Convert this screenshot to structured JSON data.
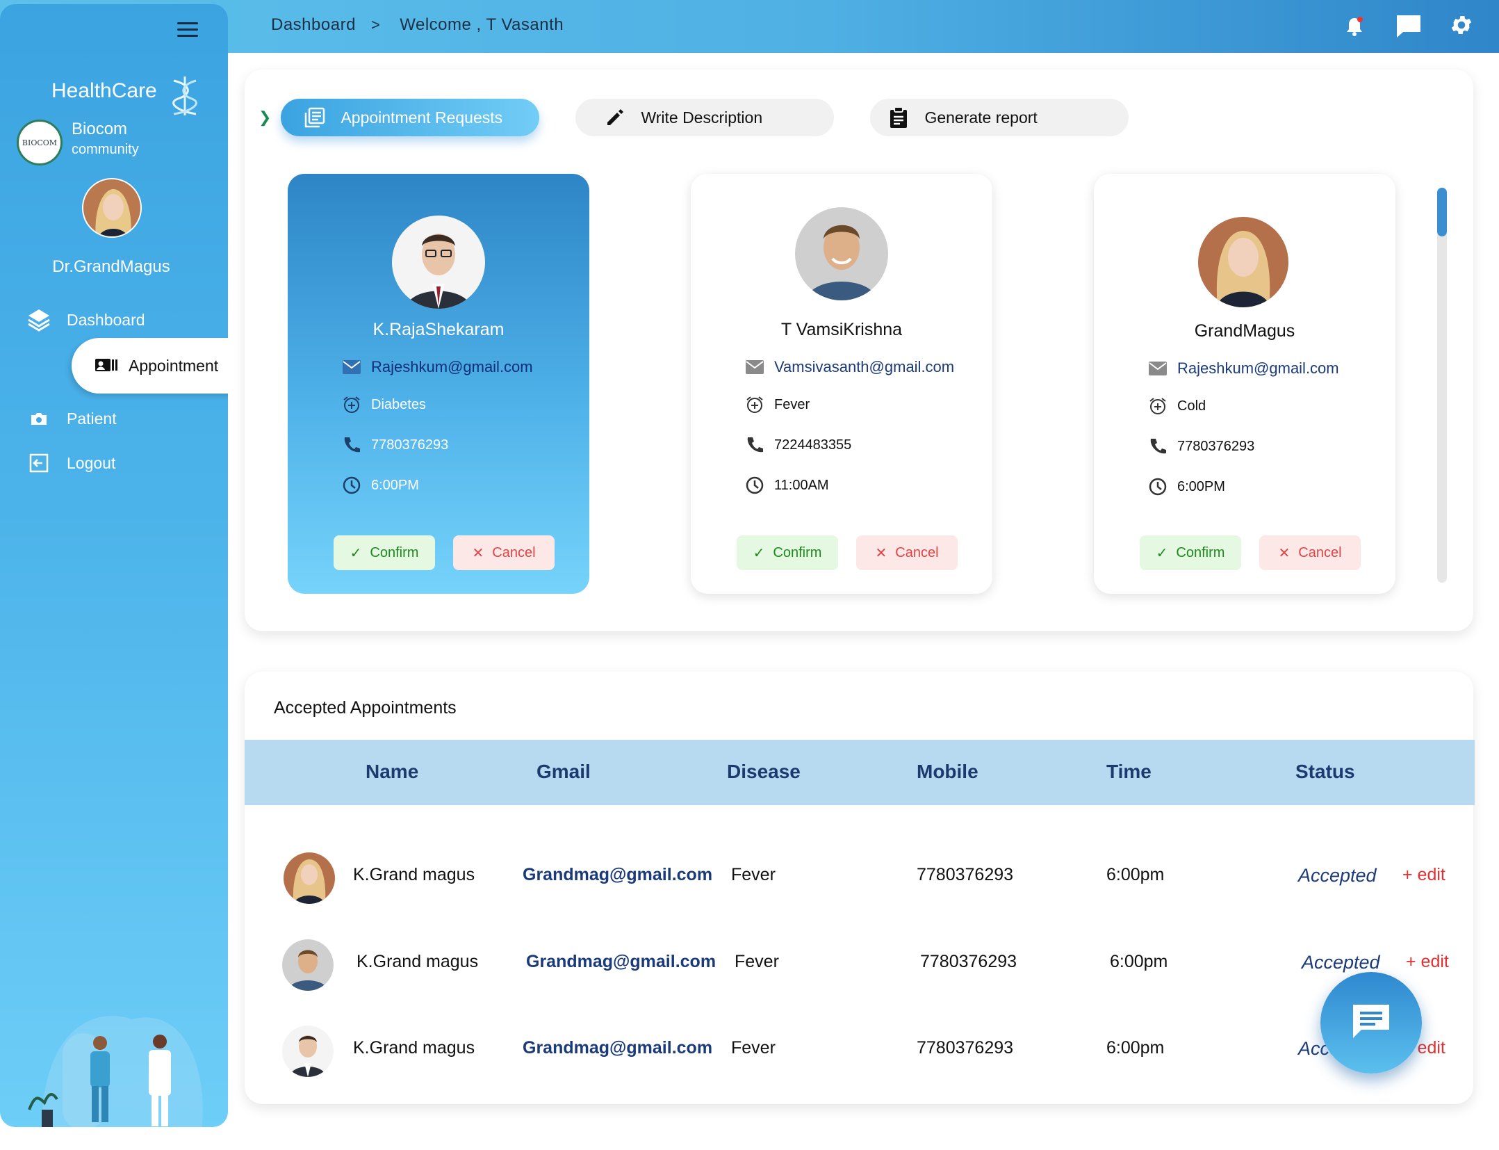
{
  "breadcrumb": {
    "root": "Dashboard",
    "separator": ">",
    "current": "Welcome , T Vasanth"
  },
  "top_icons": [
    "bell-icon",
    "chat-icon",
    "gear-icon"
  ],
  "sidebar": {
    "brand": "HealthCare",
    "org": {
      "badge": "BIOCOM",
      "name": "Biocom",
      "sub": "community"
    },
    "doctor_name": "Dr.GrandMagus",
    "nav": [
      {
        "label": "Dashboard",
        "icon": "layers-icon"
      },
      {
        "label": "Appointment",
        "icon": "id-card-icon",
        "active": true
      },
      {
        "label": "Patient",
        "icon": "camera-icon"
      },
      {
        "label": "Logout",
        "icon": "logout-icon"
      }
    ]
  },
  "tabs": [
    {
      "label": "Appointment Requests",
      "icon": "list-icon",
      "active": true
    },
    {
      "label": "Write Description",
      "icon": "pencil-icon"
    },
    {
      "label": "Generate report",
      "icon": "clipboard-icon"
    }
  ],
  "requests": [
    {
      "name": "K.RajaShekaram",
      "email": "Rajeshkum@gmail.com",
      "disease": "Diabetes",
      "phone": "7780376293",
      "time": "6:00PM",
      "confirm": "Confirm",
      "cancel": "Cancel",
      "selected": true
    },
    {
      "name": "T VamsiKrishna",
      "email": "Vamsivasanth@gmail.com",
      "disease": "Fever",
      "phone": "7224483355",
      "time": "11:00AM",
      "confirm": "Confirm",
      "cancel": "Cancel"
    },
    {
      "name": "GrandMagus",
      "email": "Rajeshkum@gmail.com",
      "disease": "Cold",
      "phone": "7780376293",
      "time": "6:00PM",
      "confirm": "Confirm",
      "cancel": "Cancel"
    }
  ],
  "accepted": {
    "title": "Accepted Appointments",
    "columns": [
      "Name",
      "Gmail",
      "Disease",
      "Mobile",
      "Time",
      "Status"
    ],
    "rows": [
      {
        "name": "K.Grand magus",
        "gmail": "Grandmag@gmail.com",
        "disease": "Fever",
        "mobile": "7780376293",
        "time": "6:00pm",
        "status": "Accepted",
        "edit": "+ edit"
      },
      {
        "name": "K.Grand magus",
        "gmail": "Grandmag@gmail.com",
        "disease": "Fever",
        "mobile": "7780376293",
        "time": "6:00pm",
        "status": "Accepted",
        "edit": "+ edit"
      },
      {
        "name": "K.Grand magus",
        "gmail": "Grandmag@gmail.com",
        "disease": "Fever",
        "mobile": "7780376293",
        "time": "6:00pm",
        "status": "Accepted",
        "edit": "+ edit"
      }
    ]
  },
  "colors": {
    "primary": "#3ba3e0",
    "confirm": "#1e8a1e",
    "cancel": "#e04444",
    "edit": "#e43030",
    "header_row": "#b7daf0"
  }
}
